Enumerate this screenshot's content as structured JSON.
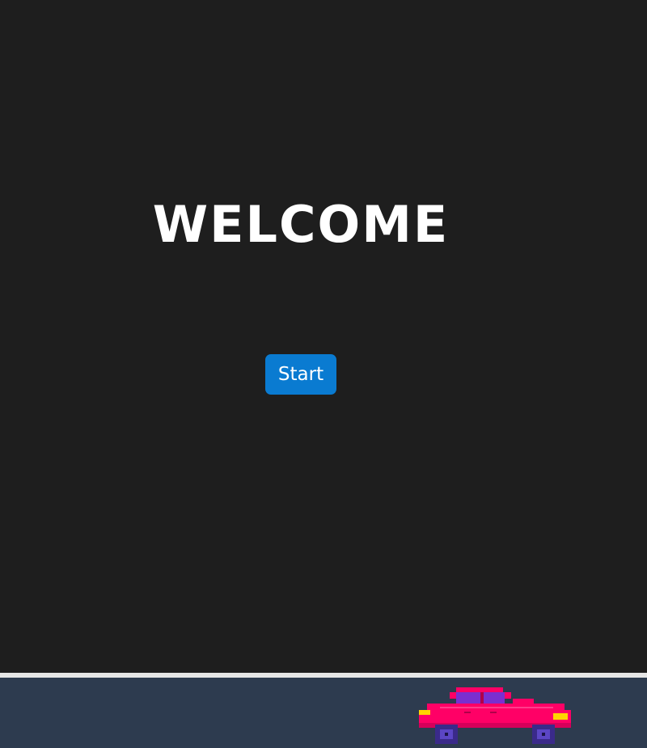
{
  "screen": {
    "title": "WELCOME",
    "start_label": "Start"
  },
  "sprites": {
    "car_icon": "pixel-car-icon",
    "car_body_color": "#ff0066",
    "car_window_color": "#8a2be2",
    "car_wheel_color": "#3a2a8a",
    "headlight_color": "#ffd400"
  },
  "colors": {
    "background": "#1e1e1e",
    "button": "#0a7bd1",
    "road": "#2d3b4f",
    "divider": "#e6e6e6"
  }
}
